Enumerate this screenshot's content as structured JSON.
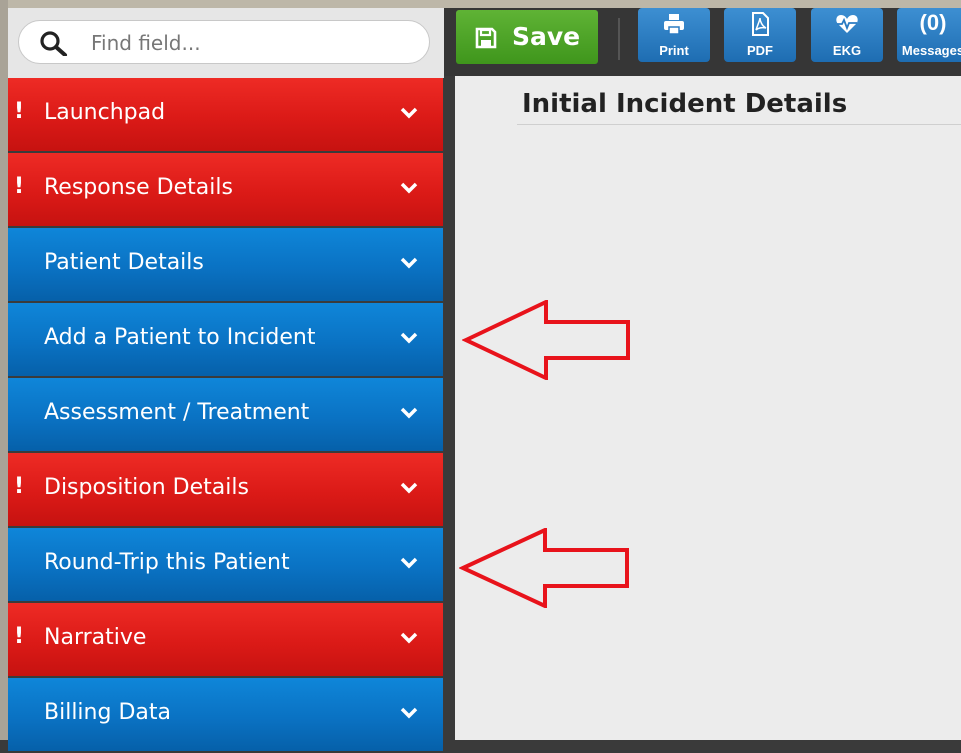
{
  "search": {
    "placeholder": "Find field..."
  },
  "toolbar": {
    "save_label": "Save",
    "print_label": "Print",
    "pdf_label": "PDF",
    "ekg_label": "EKG",
    "messages_count": "(0)",
    "messages_label": "Messages"
  },
  "sidebar": {
    "items": [
      {
        "label": "Launchpad",
        "status": "alert",
        "color": "#dd1c18"
      },
      {
        "label": "Response Details",
        "status": "alert",
        "color": "#dd1c18"
      },
      {
        "label": "Patient Details",
        "status": "normal",
        "color": "#0a72c3"
      },
      {
        "label": "Add a Patient to Incident",
        "status": "normal",
        "color": "#0a72c3"
      },
      {
        "label": "Assessment / Treatment",
        "status": "normal",
        "color": "#0a72c3"
      },
      {
        "label": "Disposition Details",
        "status": "alert",
        "color": "#dd1c18"
      },
      {
        "label": "Round-Trip this Patient",
        "status": "normal",
        "color": "#0a72c3"
      },
      {
        "label": "Narrative",
        "status": "alert",
        "color": "#dd1c18"
      },
      {
        "label": "Billing Data",
        "status": "normal",
        "color": "#0a72c3"
      }
    ],
    "alert_mark": "!"
  },
  "main": {
    "title": "Initial Incident Details"
  },
  "annotations": {
    "arrow_color": "#e8131b",
    "arrow_count": 2
  }
}
